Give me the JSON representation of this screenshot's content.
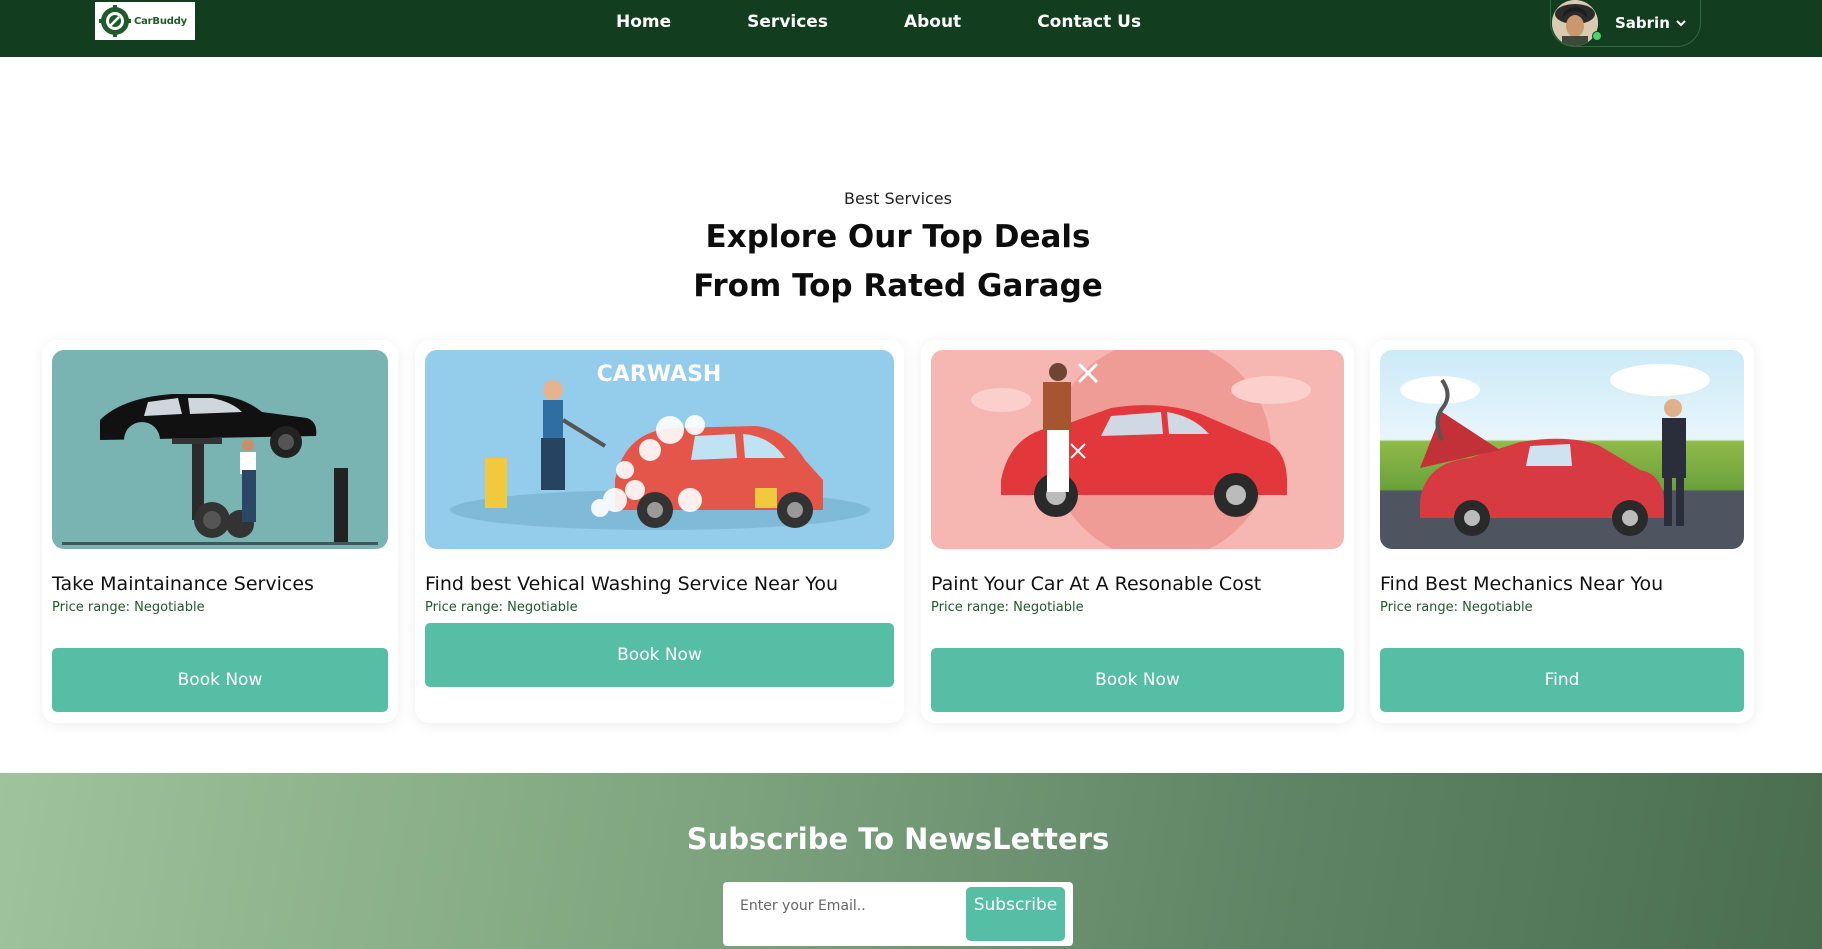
{
  "brand": {
    "name": "CarBuddy"
  },
  "nav": {
    "links": [
      "Home",
      "Services",
      "About",
      "Contact Us"
    ],
    "user": {
      "name": "Sabrin"
    }
  },
  "hero": {
    "eyebrow": "Best Services",
    "title_line1": "Explore Our Top Deals",
    "title_line2": "From Top Rated Garage"
  },
  "cards": [
    {
      "title": "Take Maintainance Services",
      "price": "Price range: Negotiable",
      "button": "Book Now"
    },
    {
      "title": "Find best Vehical Washing Service Near You",
      "price": "Price range: Negotiable",
      "button": "Book Now",
      "image_text": "CARWASH"
    },
    {
      "title": "Paint Your Car At A Resonable Cost",
      "price": "Price range: Negotiable",
      "button": "Book Now"
    },
    {
      "title": "Find Best Mechanics Near You",
      "price": "Price range: Negotiable",
      "button": "Find"
    }
  ],
  "newsletter": {
    "title": "Subscribe To NewsLetters",
    "placeholder": "Enter your Email..",
    "button": "Subscribe"
  },
  "colors": {
    "nav_bg": "#123d1e",
    "accent": "#55bea4",
    "price_text": "#1d5a2a"
  }
}
